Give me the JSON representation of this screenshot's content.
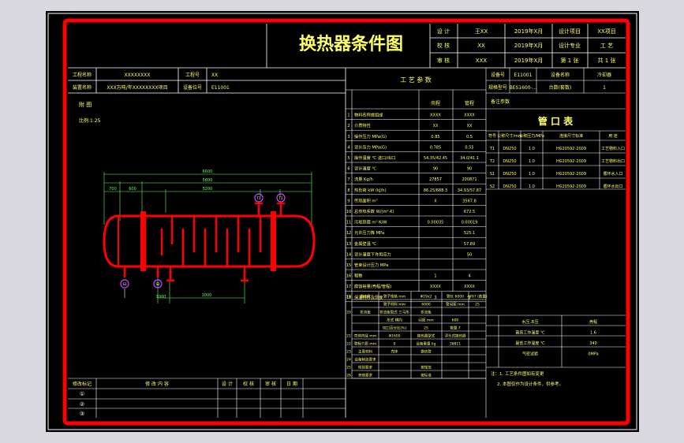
{
  "title": "换热器条件图",
  "header_grid": {
    "row1": [
      "设 计",
      "王XX",
      "2019年X月",
      "设计项目",
      "XX项目"
    ],
    "row2": [
      "校 核",
      "XX",
      "2019年X月",
      "设计专业",
      "工 艺"
    ],
    "row3": [
      "审 核",
      "XXX",
      "2019年X月",
      "第 1 张",
      "共 1 张"
    ]
  },
  "project_info": {
    "project_label": "工程名称",
    "project_value": "XXXXXXXX",
    "item_label": "工程号",
    "item_value": "XX",
    "unit_label": "装置名称",
    "unit_value": "XXX万吨/年XXXXXXXX项目",
    "equip_label": "设备位号",
    "equip_value": "E11001"
  },
  "notes": {
    "label": "附 图",
    "scale": "比例:1:25"
  },
  "process_params": {
    "header": "工 艺 参 数",
    "col_shell": "壳程",
    "col_tube": "管程",
    "rows": [
      {
        "no": "1",
        "name": "物料名称或组成",
        "shell": "XXXX",
        "tube": "XXXX"
      },
      {
        "no": "2",
        "name": "介质特性",
        "shell": "XX",
        "tube": "XX"
      },
      {
        "no": "3",
        "name": "操作压力 MPa(G)",
        "shell": "0.85",
        "tube": "0.5"
      },
      {
        "no": "4",
        "name": "设计压力 MPa(G)",
        "shell": "0.785",
        "tube": "0.55"
      },
      {
        "no": "5",
        "name": "操作温度 ℃ 进口/出口",
        "shell": "54.35/42.45",
        "tube": "34.0/41.1"
      },
      {
        "no": "6",
        "name": "设计温度 ℃",
        "shell": "90",
        "tube": "90"
      },
      {
        "no": "7",
        "name": "流量 Kg/h",
        "shell": "27857",
        "tube": "200871"
      },
      {
        "no": "8",
        "name": "热负荷 kW (kJ/h)",
        "shell": "86.25/688.3",
        "tube": "34.93/57.87"
      },
      {
        "no": "9",
        "name": "传热面积 m²",
        "shell": "X",
        "tube": "3567.8"
      },
      {
        "no": "10",
        "name": "总传热系数 W/(m²·K)",
        "shell": "",
        "tube": "672.5"
      },
      {
        "no": "11",
        "name": "污垢热阻 m²·K/W",
        "shell": "0.00035",
        "tube": "0.00019"
      },
      {
        "no": "12",
        "name": "允许压力降 MPa",
        "shell": "",
        "tube": "525.1"
      },
      {
        "no": "13",
        "name": "金属壁温 ℃",
        "shell": "",
        "tube": "57.89"
      },
      {
        "no": "14",
        "name": "设计温度下许用应力",
        "shell": "",
        "tube": "50"
      },
      {
        "no": "15",
        "name": "管束设计压力 MPa",
        "shell": "",
        "tube": ""
      },
      {
        "no": "16",
        "name": "程数",
        "shell": "1",
        "tube": "4"
      },
      {
        "no": "17",
        "name": "腐蚀裕量(壳程/管程)",
        "shell": "XXXX",
        "tube": "XXXX"
      },
      {
        "no": "18",
        "name": "保温材料及厚度",
        "shell": "3",
        "tube": "3"
      }
    ],
    "extra": [
      {
        "no": "19",
        "label": "换热管",
        "a": "管子规格 mm",
        "b": "Φ19x2",
        "c": "管长 6000",
        "d": "4767 (数量)"
      },
      {
        "no": "19b",
        "label": "",
        "a": "管子材料 mm",
        "b": "6000",
        "c": "管间距 mm",
        "d": "25"
      },
      {
        "no": "20",
        "label": "折流板",
        "a": "折流板型式 三弓形",
        "b": "折流板",
        "c": "",
        "d": ""
      },
      {
        "no": "20b",
        "label": "",
        "a": "形式 横向",
        "b": "间距 mm",
        "c": "600",
        "d": ""
      },
      {
        "no": "20c",
        "label": "",
        "a": "切口百分比(%)",
        "b": "25",
        "c": "数量 7",
        "d": ""
      },
      {
        "no": "21",
        "label": "壳体内径 mm",
        "a": "Φ1600",
        "b": "换热器型式",
        "c": "浮头式换热器",
        "d": ""
      },
      {
        "no": "22",
        "label": "管程介质 mm",
        "a": "0",
        "b": "设备重量 kg",
        "c": "38811",
        "d": ""
      },
      {
        "no": "23",
        "label": "主要材料",
        "a": "壳体",
        "b": "换热管",
        "c": "",
        "d": ""
      },
      {
        "no": "24",
        "label": "设备制造要求",
        "a": "",
        "b": "",
        "c": "",
        "d": ""
      },
      {
        "no": "25",
        "label": "检验要求",
        "a": "",
        "b": "按规范",
        "c": "",
        "d": ""
      },
      {
        "no": "26",
        "label": "其他要求",
        "a": "",
        "b": "按标准",
        "c": "",
        "d": ""
      }
    ]
  },
  "right_info": {
    "r1": [
      "设备号",
      "E11001",
      "设备名称",
      "冷却器"
    ],
    "r2": [
      "规格型号",
      "BES1600-...",
      "台数(套数)",
      "1"
    ],
    "r3": "备注参数"
  },
  "nozzle_table": {
    "header": "管 口 表",
    "cols": [
      "符号",
      "公称尺寸/mm",
      "公称压力/MPa",
      "连接尺寸标准",
      "用 途"
    ],
    "rows": [
      [
        "T1",
        "DN250",
        "1.0",
        "HG20592-2009",
        "工艺物料入口"
      ],
      [
        "T2",
        "DN250",
        "1.0",
        "HG20592-2009",
        "工艺物料出口"
      ],
      [
        "S1",
        "DN250",
        "1.0",
        "HG20592-2009",
        "循环水入口"
      ],
      [
        "S2",
        "DN250",
        "1.0",
        "HG20592-2009",
        "循环水出口"
      ]
    ]
  },
  "side_params": {
    "rows": [
      [
        "水压,本压",
        "",
        "壳程"
      ],
      [
        "最高工作温度 ℃",
        "",
        "1.6"
      ],
      [
        "最低工作温度 ℃",
        "",
        "340"
      ],
      [
        "气密试验",
        "",
        "0MPa"
      ]
    ],
    "note1": "注：1. 工艺条件图如有变更",
    "note2": "2. 本图仅作为设计条件，供参考。"
  },
  "revision": {
    "rows": [
      "修改标记",
      "①",
      "②",
      "③"
    ],
    "cols": [
      "修 改 内 容",
      "设 计",
      "校 核",
      "审 核",
      "日 期"
    ]
  },
  "drawing": {
    "dim_total": "6600",
    "dim_mid": "5800",
    "dim_inner": "5200",
    "dim_left": "700",
    "dim_l2": "600",
    "dim_bottom": "1000",
    "dim_bottom2": "1000",
    "nozzle_T1": "T1",
    "nozzle_T2": "T2",
    "nozzle_S1": "S1",
    "nozzle_S2": "S2"
  }
}
